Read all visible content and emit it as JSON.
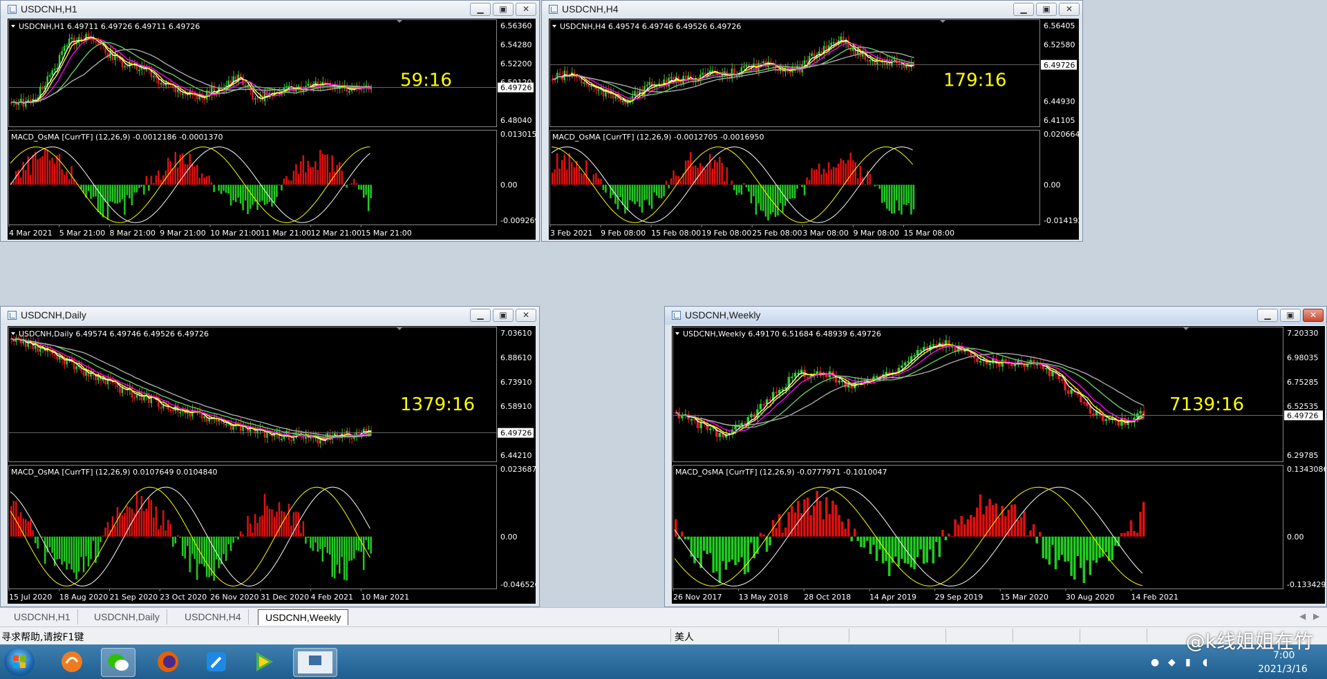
{
  "colors": {
    "bull": "#33cc33",
    "bear": "#e02020",
    "ma_white": "#ffffff",
    "ma_yellow": "#ffff00",
    "ma_magenta": "#ff00ff",
    "ma_green": "#66cc66",
    "ma_gray": "#aaaaaa",
    "timer": "#ffff00",
    "hist_up": "#e01010",
    "hist_down": "#22cc22"
  },
  "windows": [
    {
      "id": "h1",
      "title": "USDCNH,H1",
      "info": "USDCNH,H1  6.49711 6.49726 6.49711 6.49726",
      "timer": "59:16",
      "price_ticks": [
        "6.56360",
        "6.54280",
        "6.52200",
        "6.50120",
        "6.49726",
        "6.48040"
      ],
      "last_price": "6.49726",
      "osc_label": "MACD_OsMA [CurrTF] (12,26,9) -0.0012186 -0.0001370",
      "osc_ticks": [
        "0.0130151",
        "0.00",
        "-0.0092699"
      ],
      "dates": [
        "4 Mar 2021",
        "5 Mar 21:00",
        "8 Mar 21:00",
        "9 Mar 21:00",
        "10 Mar 21:00",
        "11 Mar 21:00",
        "12 Mar 21:00",
        "15 Mar 21:00"
      ],
      "close_red": false
    },
    {
      "id": "h4",
      "title": "USDCNH,H4",
      "info": "USDCNH,H4  6.49574 6.49746 6.49526 6.49726",
      "timer": "179:16",
      "price_ticks": [
        "6.56405",
        "6.52580",
        "6.48755",
        "6.49726",
        "6.44930",
        "6.41105"
      ],
      "last_price": "6.49726",
      "osc_label": "MACD_OsMA [CurrTF] (12,26,9) -0.0012705 -0.0016950",
      "osc_ticks": [
        "0.0206644",
        "0.00",
        "-0.0141923"
      ],
      "dates": [
        "3 Feb 2021",
        "9 Feb 08:00",
        "15 Feb 08:00",
        "19 Feb 08:00",
        "25 Feb 08:00",
        "3 Mar 08:00",
        "9 Mar 08:00",
        "15 Mar 08:00"
      ],
      "close_red": false
    },
    {
      "id": "daily",
      "title": "USDCNH,Daily",
      "info": "USDCNH,Daily  6.49574 6.49746 6.49526 6.49726",
      "timer": "1379:16",
      "price_ticks": [
        "7.03610",
        "6.88610",
        "6.73910",
        "6.58910",
        "6.49726",
        "6.44210"
      ],
      "last_price": "6.49726",
      "osc_label": "MACD_OsMA [CurrTF] (12,26,9) 0.0107649 0.0104840",
      "osc_ticks": [
        "0.023687",
        "0.00",
        "-0.046526"
      ],
      "dates": [
        "15 Jul 2020",
        "18 Aug 2020",
        "21 Sep 2020",
        "23 Oct 2020",
        "26 Nov 2020",
        "31 Dec 2020",
        "4 Feb 2021",
        "10 Mar 2021"
      ],
      "close_red": false
    },
    {
      "id": "weekly",
      "title": "USDCNH,Weekly",
      "info": "USDCNH,Weekly  6.49170 6.51684 6.48939 6.49726",
      "timer": "7139:16",
      "price_ticks": [
        "7.20330",
        "6.98035",
        "6.75285",
        "6.52535",
        "6.49726",
        "6.29785"
      ],
      "last_price": "6.49726",
      "osc_label": "MACD_OsMA [CurrTF] (12,26,9) -0.0777971 -0.1010047",
      "osc_ticks": [
        "0.1343086",
        "0.00",
        "-0.1334299"
      ],
      "dates": [
        "26 Nov 2017",
        "13 May 2018",
        "28 Oct 2018",
        "14 Apr 2019",
        "29 Sep 2019",
        "15 Mar 2020",
        "30 Aug 2020",
        "14 Feb 2021"
      ],
      "close_red": true
    }
  ],
  "tabs": [
    "USDCNH,H1",
    "USDCNH,Daily",
    "USDCNH,H4",
    "USDCNH,Weekly"
  ],
  "active_tab": 3,
  "status": {
    "help": "寻求帮助,请按F1键",
    "profile": "美人"
  },
  "tray": {
    "time": "7:00",
    "date": "2021/3/16"
  },
  "watermark": "@k线姐姐在竹",
  "window_buttons": {
    "minimize": "▁",
    "restore": "▣",
    "close": "✕"
  }
}
